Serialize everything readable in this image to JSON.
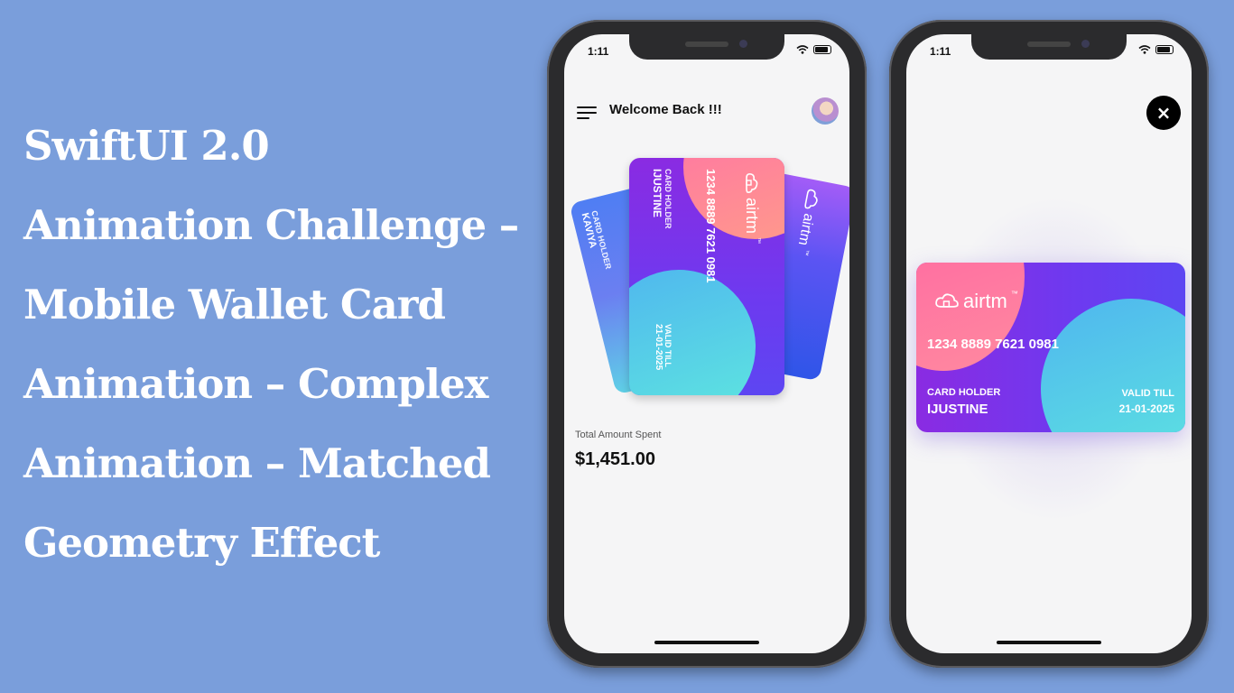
{
  "headline": {
    "lines": [
      "SwiftUI 2.0",
      "Animation Challenge –",
      "Mobile Wallet Card",
      "Animation – Complex",
      "Animation – Matched",
      "Geometry Effect"
    ]
  },
  "phone_left": {
    "status_time": "1:11",
    "header_title": "Welcome Back !!!",
    "cards": {
      "back_left": {
        "holder_label": "CARD HOLDER",
        "holder_name": "KAVIYA"
      },
      "front": {
        "brand": "airtm",
        "trademark": "™",
        "number": "1234 8889 7621 0981",
        "holder_label": "CARD HOLDER",
        "holder_name": "IJUSTINE",
        "valid_label": "VALID TILL",
        "valid_date": "21-01-2025"
      },
      "back_right": {
        "brand": "airtm",
        "trademark": "™"
      }
    },
    "total_label": "Total Amount Spent",
    "total_value": "$1,451.00"
  },
  "phone_right": {
    "status_time": "1:11",
    "close_icon": "×",
    "card": {
      "brand": "airtm",
      "trademark": "™",
      "number": "1234 8889 7621 0981",
      "holder_label": "CARD HOLDER",
      "holder_name": "IJUSTINE",
      "valid_label": "VALID TILL",
      "valid_date": "21-01-2025"
    }
  },
  "colors": {
    "background": "#7a9edb",
    "card_purple": "#7b2ff7",
    "card_pink": "#ff5fa2",
    "card_teal": "#5ee7df",
    "card_blue": "#4f6bf0"
  }
}
